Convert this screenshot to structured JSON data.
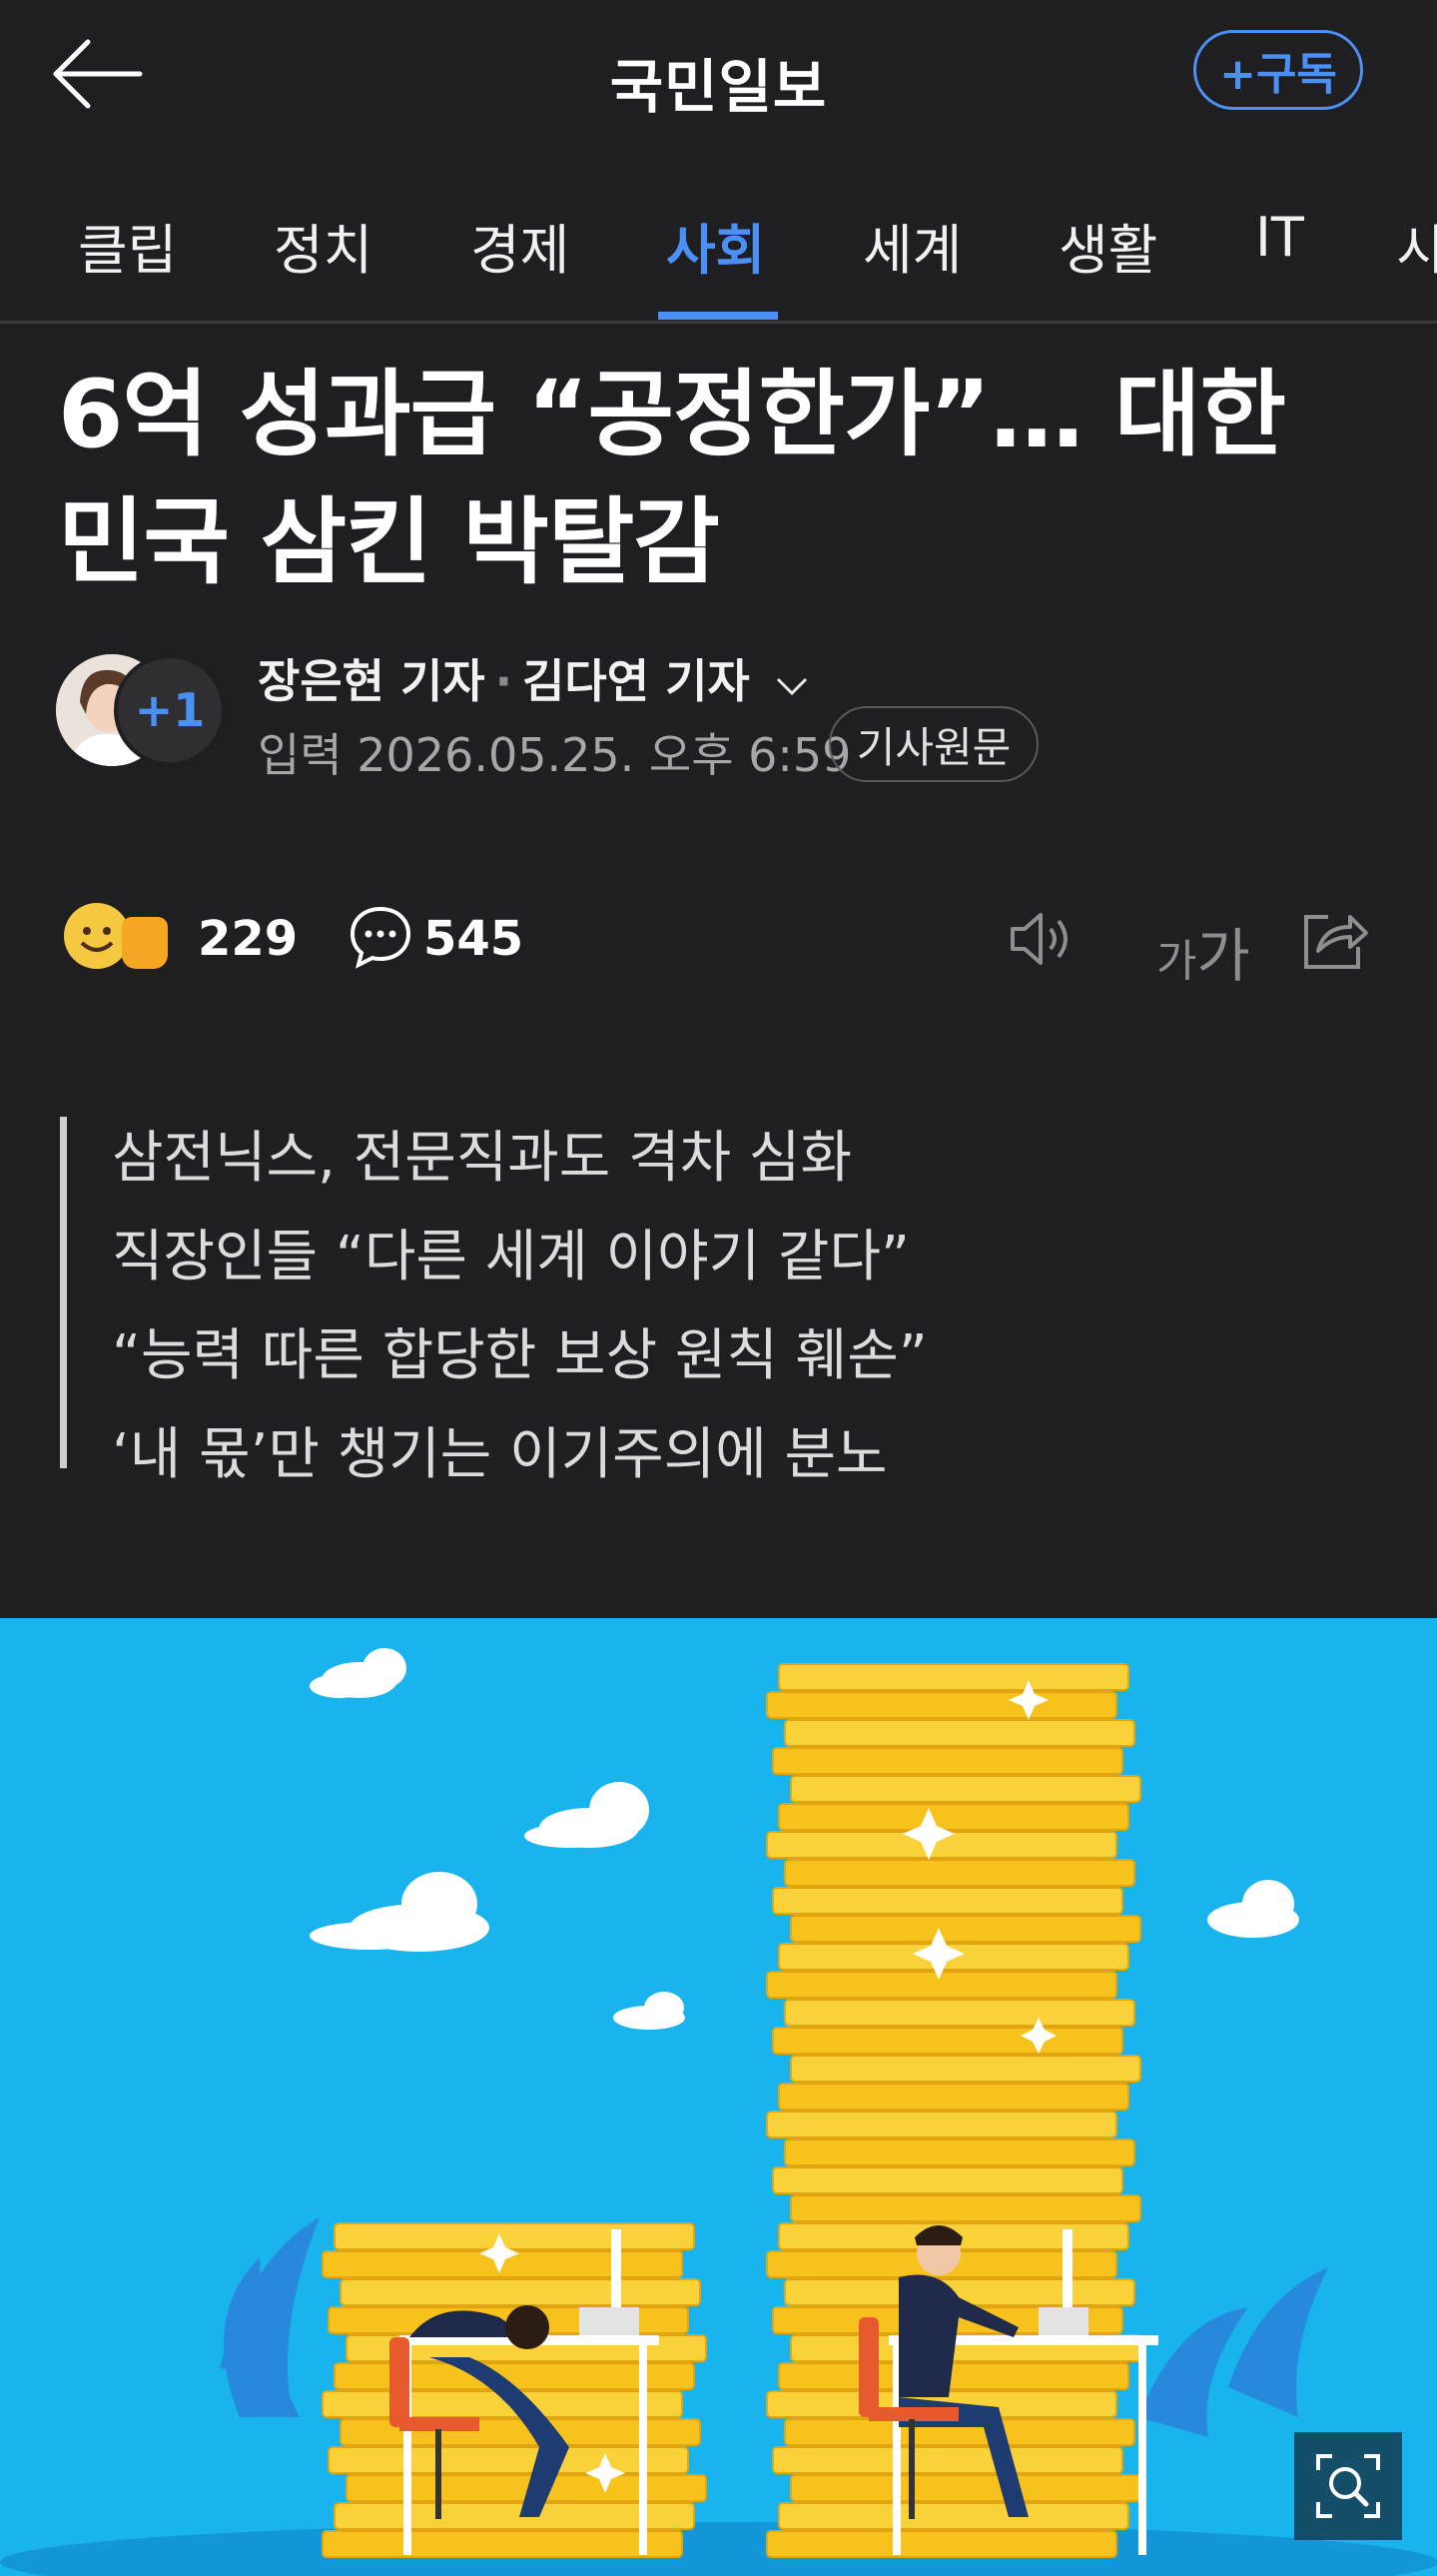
{
  "header": {
    "brand": "국민일보",
    "subscribe_label": "+구독"
  },
  "tabs": [
    {
      "label": "클립"
    },
    {
      "label": "정치"
    },
    {
      "label": "경제"
    },
    {
      "label": "사회",
      "active": true
    },
    {
      "label": "세계"
    },
    {
      "label": "생활"
    },
    {
      "label": "IT"
    },
    {
      "label": "시"
    }
  ],
  "article": {
    "headline_line1": "6억 성과급 “공정한가”… 대한",
    "headline_line2": "민국 삼킨 박탈감",
    "reporters": [
      "장은현 기자",
      "김다연 기자"
    ],
    "reporter_more": "+1",
    "date": "입력 2026.05.25. 오후 6:59",
    "original_label": "기사원문",
    "likes": "229",
    "comments": "545",
    "font_icon_small": "가",
    "font_icon_big": "가",
    "summary": [
      "삼전닉스, 전문직과도 격차 심화",
      "직장인들 “다른 세계 이야기 같다”",
      "“능력 따른 합당한 보상 원칙 훼손”",
      "‘내 몫’만 챙기는 이기주의에 분노"
    ]
  },
  "colors": {
    "background": "#1f1f21",
    "accent": "#4a90f5",
    "illustration_sky": "#19b4ee",
    "coin": "#f6c21b"
  },
  "icons": {
    "back": "arrow-left-icon",
    "emoji": "smile-thumbs-up-icon",
    "comment": "speech-bubble-icon",
    "speaker": "speaker-icon",
    "font": "font-size-icon",
    "share": "share-icon",
    "zoom": "zoom-search-icon"
  }
}
